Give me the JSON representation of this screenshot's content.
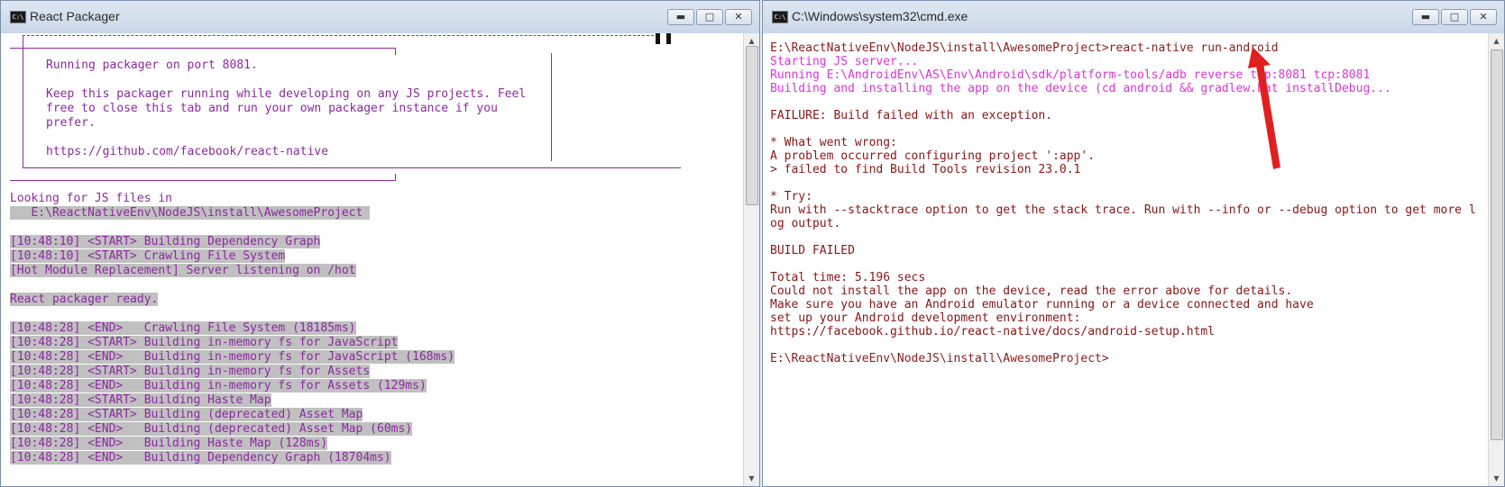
{
  "left_window": {
    "title": "React Packager",
    "icon_text": "C:\\",
    "controls": [
      "minimize",
      "maximize",
      "close"
    ],
    "banner_lines": [
      "Running packager on port 8081.",
      "",
      "Keep this packager running while developing on any JS projects. Feel",
      "free to close this tab and run your own packager instance if you",
      "prefer.",
      "",
      "https://github.com/facebook/react-native"
    ],
    "log_lines": [
      {
        "text": "Looking for JS files in",
        "hl": false
      },
      {
        "text": "   E:\\ReactNativeEnv\\NodeJS\\install\\AwesomeProject ",
        "hl": true,
        "indent": true
      },
      {
        "text": "",
        "hl": false
      },
      {
        "text": "[10:48:10] <START> Building Dependency Graph",
        "hl": true
      },
      {
        "text": "[10:48:10] <START> Crawling File System",
        "hl": true
      },
      {
        "text": "[Hot Module Replacement] Server listening on /hot",
        "hl": true
      },
      {
        "text": "",
        "hl": false
      },
      {
        "text": "React packager ready.",
        "hl": true
      },
      {
        "text": "",
        "hl": false
      },
      {
        "text": "[10:48:28] <END>   Crawling File System (18185ms)",
        "hl": true
      },
      {
        "text": "[10:48:28] <START> Building in-memory fs for JavaScript",
        "hl": true
      },
      {
        "text": "[10:48:28] <END>   Building in-memory fs for JavaScript (168ms)",
        "hl": true
      },
      {
        "text": "[10:48:28] <START> Building in-memory fs for Assets",
        "hl": true
      },
      {
        "text": "[10:48:28] <END>   Building in-memory fs for Assets (129ms)",
        "hl": true
      },
      {
        "text": "[10:48:28] <START> Building Haste Map",
        "hl": true
      },
      {
        "text": "[10:48:28] <START> Building (deprecated) Asset Map",
        "hl": true
      },
      {
        "text": "[10:48:28] <END>   Building (deprecated) Asset Map (60ms)",
        "hl": true
      },
      {
        "text": "[10:48:28] <END>   Building Haste Map (128ms)",
        "hl": true
      },
      {
        "text": "[10:48:28] <END>   Building Dependency Graph (18704ms)",
        "hl": true
      }
    ]
  },
  "right_window": {
    "title": "C:\\Windows\\system32\\cmd.exe",
    "icon_text": "C:\\",
    "controls": [
      "minimize",
      "maximize",
      "close"
    ],
    "lines": [
      {
        "text": "",
        "cls": "red"
      },
      {
        "text": "E:\\ReactNativeEnv\\NodeJS\\install\\AwesomeProject>react-native run-android",
        "cls": "red"
      },
      {
        "text": "Starting JS server...",
        "cls": "mag"
      },
      {
        "text": "Running E:\\AndroidEnv\\AS\\Env\\Android\\sdk/platform-tools/adb reverse tcp:8081 tcp:8081",
        "cls": "mag"
      },
      {
        "text": "Building and installing the app on the device (cd android && gradlew.bat installDebug...",
        "cls": "mag"
      },
      {
        "text": "",
        "cls": "red"
      },
      {
        "text": "FAILURE: Build failed with an exception.",
        "cls": "maroon"
      },
      {
        "text": "",
        "cls": "red"
      },
      {
        "text": "* What went wrong:",
        "cls": "maroon"
      },
      {
        "text": "A problem occurred configuring project ':app'.",
        "cls": "maroon"
      },
      {
        "text": "> failed to find Build Tools revision 23.0.1",
        "cls": "maroon"
      },
      {
        "text": "",
        "cls": "red"
      },
      {
        "text": "* Try:",
        "cls": "maroon"
      },
      {
        "text": "Run with --stacktrace option to get the stack trace. Run with --info or --debug option to get more l",
        "cls": "maroon",
        "try": true
      },
      {
        "text": "og output.",
        "cls": "maroon"
      },
      {
        "text": "",
        "cls": "red"
      },
      {
        "text": "BUILD FAILED",
        "cls": "maroon"
      },
      {
        "text": "",
        "cls": "red"
      },
      {
        "text": "Total time: 5.196 secs",
        "cls": "maroon"
      },
      {
        "text": "Could not install the app on the device, read the error above for details.",
        "cls": "maroon"
      },
      {
        "text": "Make sure you have an Android emulator running or a device connected and have",
        "cls": "maroon"
      },
      {
        "text": "set up your Android development environment:",
        "cls": "maroon"
      },
      {
        "text": "https://facebook.github.io/react-native/docs/android-setup.html",
        "cls": "maroon"
      },
      {
        "text": "",
        "cls": "red"
      },
      {
        "text": "E:\\ReactNativeEnv\\NodeJS\\install\\AwesomeProject>",
        "cls": "red"
      }
    ]
  },
  "colors": {
    "packager_text": "#8b2aa0",
    "selection_bg": "#c0c0c0",
    "cmd_prompt": "#8b1c1c",
    "cmd_info": "#dd33dd",
    "cmd_error": "#8a1515",
    "annotation_arrow": "#e02020"
  }
}
